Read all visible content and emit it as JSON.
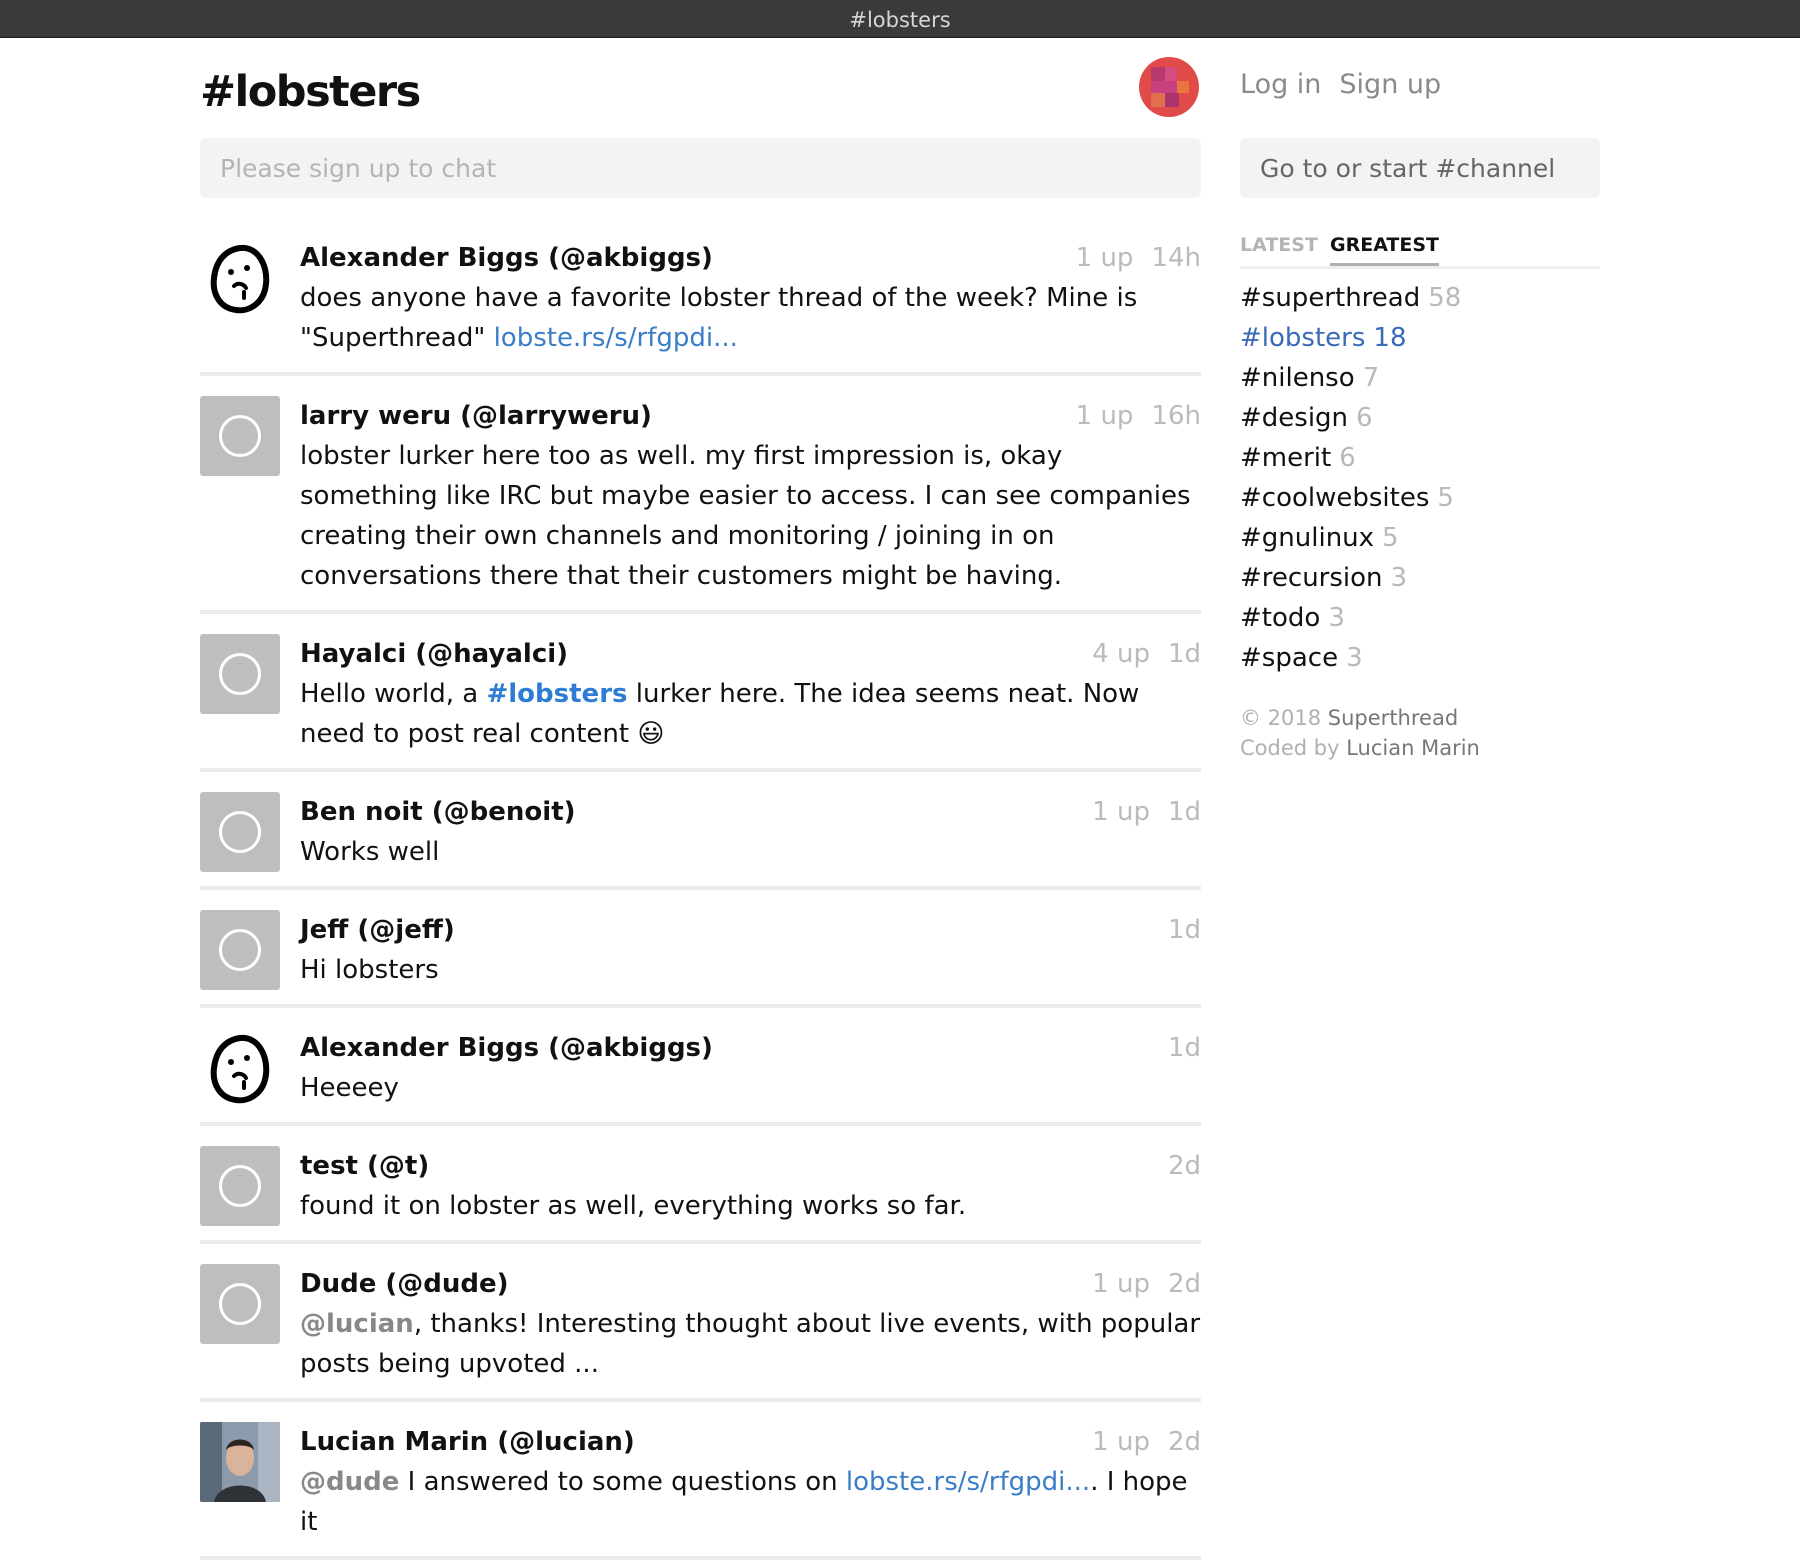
{
  "window": {
    "title": "#lobsters"
  },
  "header": {
    "logo": "#lobsters",
    "colors": {
      "avatar_accent": "#e04a48"
    }
  },
  "composer": {
    "placeholder": "Please sign up to chat"
  },
  "messages": [
    {
      "author": "Alexander Biggs (@akbiggs)",
      "avatar": "sketch-face-icon",
      "ups": "1 up",
      "time": "14h",
      "text": "does anyone have a favorite lobster thread of the week? Mine is \"Superthread\" ",
      "link": "lobste.rs/s/rfgpdi..."
    },
    {
      "author": "larry weru (@larryweru)",
      "avatar": "default-avatar-icon",
      "ups": "1 up",
      "time": "16h",
      "text": "lobster lurker here too as well. my first impression is, okay something like IRC but maybe easier to access. I can see companies creating their own channels and monitoring / joining in on conversations there that their customers might be having."
    },
    {
      "author": "Hayalci (@hayalci)",
      "avatar": "default-avatar-icon",
      "ups": "4 up",
      "time": "1d",
      "text_before": "Hello world, a ",
      "hashtag": "#lobsters",
      "text_after": " lurker here. The idea seems neat. Now need to post real content ",
      "emoji": "😃"
    },
    {
      "author": "Ben noit (@benoit)",
      "avatar": "default-avatar-icon",
      "ups": "1 up",
      "time": "1d",
      "text": "Works well"
    },
    {
      "author": "Jeff (@jeff)",
      "avatar": "default-avatar-icon",
      "time": "1d",
      "text": "Hi lobsters"
    },
    {
      "author": "Alexander Biggs (@akbiggs)",
      "avatar": "sketch-face-icon",
      "time": "1d",
      "text": "Heeeey"
    },
    {
      "author": "test (@t)",
      "avatar": "default-avatar-icon",
      "time": "2d",
      "text": "found it on lobster as well, everything works so far."
    },
    {
      "author": "Dude (@dude)",
      "avatar": "default-avatar-icon",
      "ups": "1 up",
      "time": "2d",
      "mention": "@lucian",
      "text": ", thanks! Interesting thought about live events, with popular posts being upvoted ..."
    },
    {
      "author": "Lucian Marin (@lucian)",
      "avatar": "photo-avatar",
      "ups": "1 up",
      "time": "2d",
      "mention": "@dude",
      "text_before": " I answered to some questions on ",
      "link": "lobste.rs/s/rfgpdi...",
      "text_after": ". I hope it"
    }
  ],
  "auth": {
    "login": "Log in",
    "signup": "Sign up"
  },
  "channel_search": {
    "placeholder": "Go to or start #channel"
  },
  "tabs": {
    "latest": "LATEST",
    "greatest": "GREATEST",
    "active": "greatest"
  },
  "channels": [
    {
      "name": "#superthread",
      "count": "58"
    },
    {
      "name": "#lobsters",
      "count": "18",
      "current": true
    },
    {
      "name": "#nilenso",
      "count": "7"
    },
    {
      "name": "#design",
      "count": "6"
    },
    {
      "name": "#merit",
      "count": "6"
    },
    {
      "name": "#coolwebsites",
      "count": "5"
    },
    {
      "name": "#gnulinux",
      "count": "5"
    },
    {
      "name": "#recursion",
      "count": "3"
    },
    {
      "name": "#todo",
      "count": "3"
    },
    {
      "name": "#space",
      "count": "3"
    }
  ],
  "footer": {
    "copyright_prefix": "© 2018 ",
    "brand": "Superthread",
    "coded_prefix": "Coded by ",
    "coder": "Lucian Marin"
  }
}
